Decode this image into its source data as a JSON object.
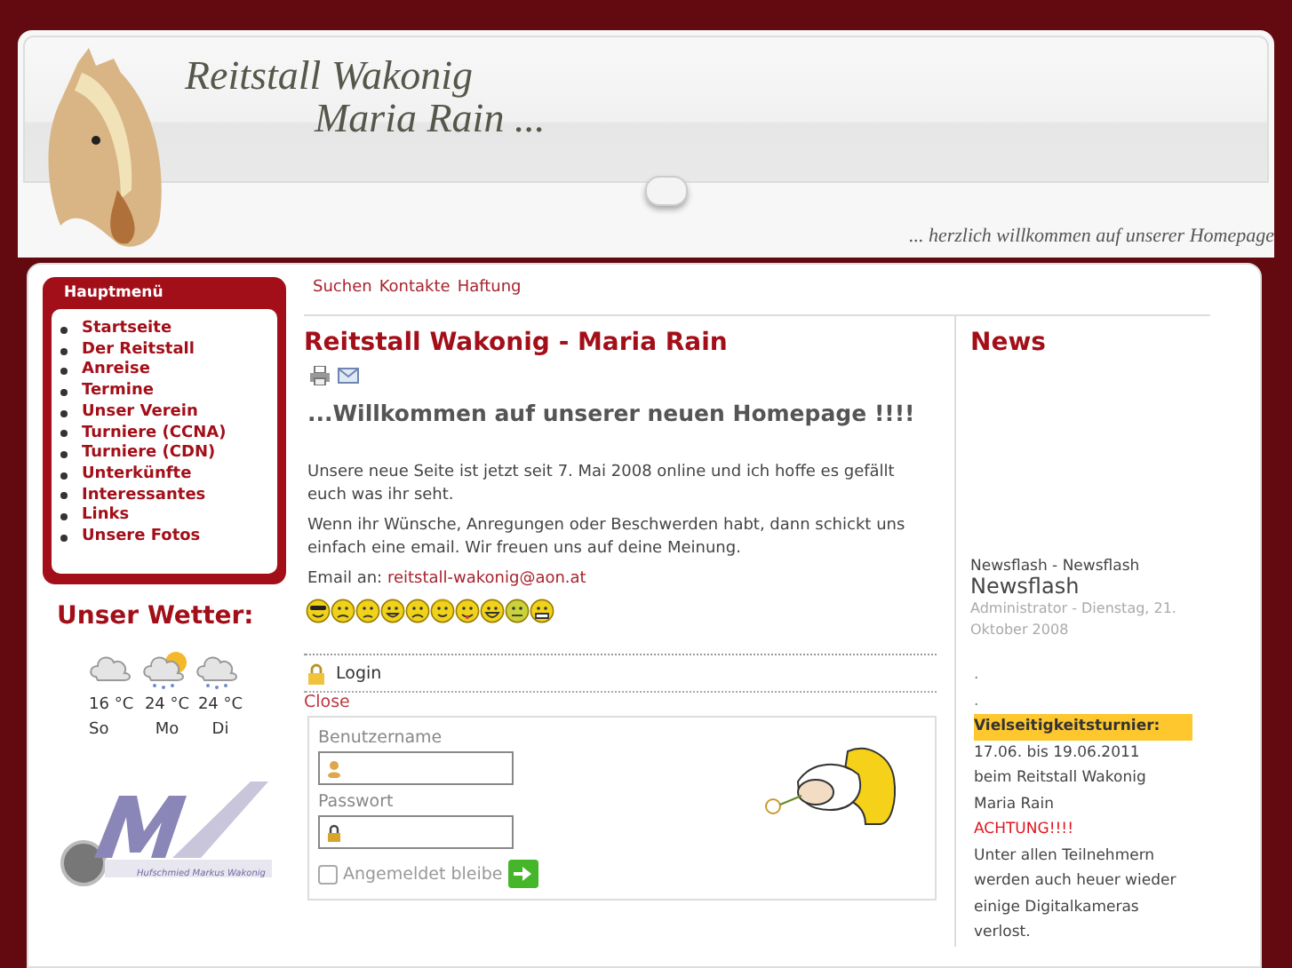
{
  "header": {
    "title_line_1": "Reitstall Wakonig",
    "title_line_2": "Maria Rain ...",
    "tagline": "... herzlich willkommen auf unserer Homepage"
  },
  "main_menu": {
    "title": "Hauptmenü",
    "items": [
      "Startseite",
      "Der Reitstall",
      "Anreise",
      "Termine",
      "Unser Verein",
      "Turniere (CCNA)",
      "Turniere (CDN)",
      "Unterkünfte",
      "Interessantes",
      "Links",
      "Unsere Fotos"
    ]
  },
  "weather": {
    "title": "Unser Wetter:",
    "days": [
      {
        "kind": "cloudy",
        "temperature": "16 °C",
        "day": "So"
      },
      {
        "kind": "sun-rain",
        "temperature": "24 °C",
        "day": "Mo"
      },
      {
        "kind": "rain",
        "temperature": "24 °C",
        "day": "Di"
      }
    ]
  },
  "logo": {
    "caption": "Hufschmied Markus Wakonig"
  },
  "top_links": [
    "Suchen",
    "Kontakte",
    "Haftung"
  ],
  "article": {
    "title": "Reitstall Wakonig - Maria Rain",
    "heading": "...Willkommen auf unserer neuen Homepage !!!!",
    "paragraphs": [
      "Unsere neue Seite ist jetzt seit 7. Mai 2008 online und ich hoffe es gefällt euch was ihr seht.",
      "Wenn ihr Wünsche, Anregungen oder Beschwerden habt, dann schickt uns einfach eine email. Wir freuen uns auf deine Meinung."
    ],
    "email_label": "Email an:",
    "email": "reitstall-wakonig@aon.at",
    "smileys": [
      {
        "kind": "cool"
      },
      {
        "kind": "crying"
      },
      {
        "kind": "sad"
      },
      {
        "kind": "grin"
      },
      {
        "kind": "frown"
      },
      {
        "kind": "angel"
      },
      {
        "kind": "tongue"
      },
      {
        "kind": "laugh"
      },
      {
        "kind": "sick"
      },
      {
        "kind": "mask"
      }
    ]
  },
  "login": {
    "title": "Login",
    "close": "Close",
    "username_label": "Benutzername",
    "password_label": "Passwort",
    "remember_label": "Angemeldet bleibe",
    "remember_checked": false
  },
  "news": {
    "title": "News",
    "category": "Newsflash - Newsflash",
    "headline": "Newsflash",
    "meta": "Administrator - Dienstag, 21. Oktober 2008",
    "lines": [
      {
        "kind": "dot",
        "text": "."
      },
      {
        "kind": "dot",
        "text": "."
      },
      {
        "kind": "highlight",
        "text": "Vielseitigkeitsturnier:"
      },
      {
        "kind": "plain",
        "text": "17.06. bis 19.06.2011"
      },
      {
        "kind": "plain",
        "text": "beim Reitstall Wakonig"
      },
      {
        "kind": "plain",
        "text": "Maria Rain"
      },
      {
        "kind": "alert",
        "text": "ACHTUNG!!!!"
      },
      {
        "kind": "plain",
        "text": "Unter allen Teilnehmern werden auch heuer wieder einige Digitalkameras verlost."
      }
    ]
  }
}
